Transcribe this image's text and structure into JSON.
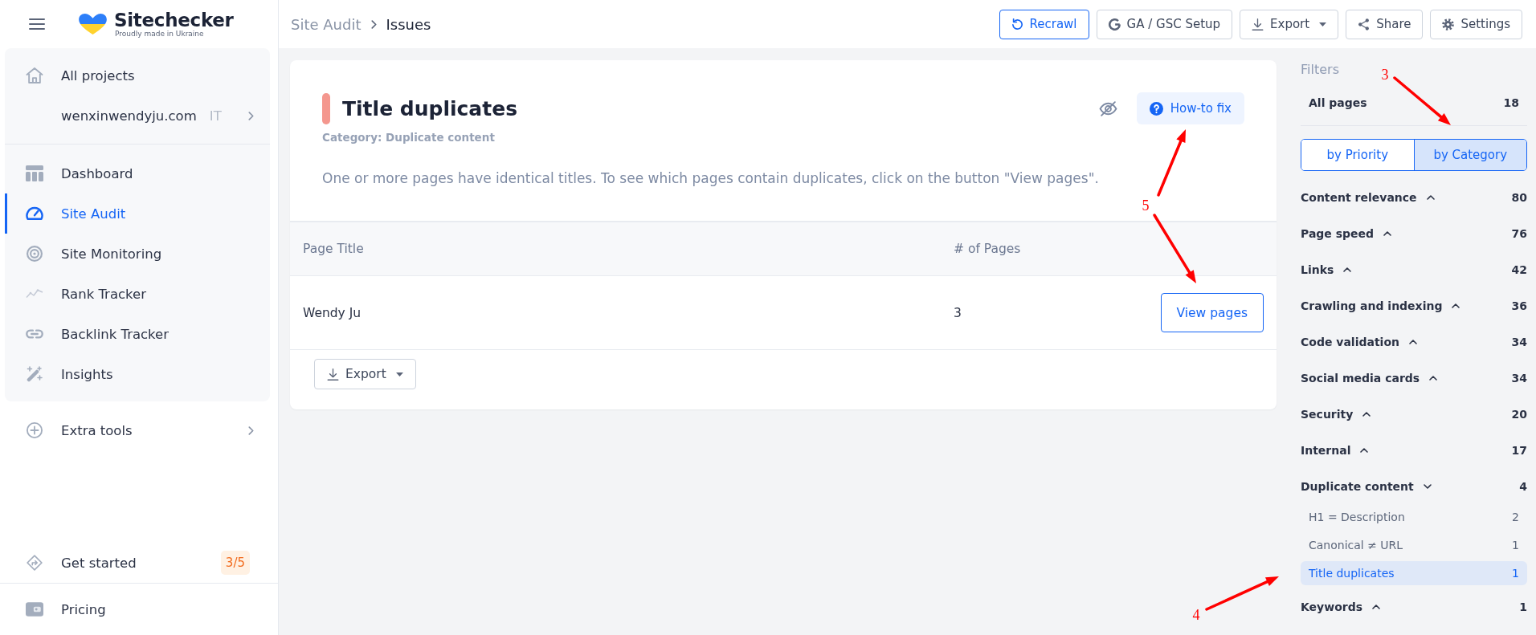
{
  "header": {
    "brand": {
      "name": "Sitechecker",
      "tagline": "Proudly made in Ukraine"
    },
    "breadcrumb": [
      "Site Audit",
      "Issues"
    ],
    "actions": [
      {
        "label": "Recrawl",
        "kind": "primary",
        "dropdown": false
      },
      {
        "label": "GA / GSC Setup",
        "kind": "default",
        "dropdown": false
      },
      {
        "label": "Export",
        "kind": "default",
        "dropdown": true
      },
      {
        "label": "Share",
        "kind": "default",
        "dropdown": false
      },
      {
        "label": "Settings",
        "kind": "default",
        "dropdown": false
      }
    ]
  },
  "sidebar": {
    "all_projects": "All projects",
    "project": {
      "label": "wenxinwendyju.com",
      "tag": "IT"
    },
    "nav": [
      {
        "label": "Dashboard",
        "selected": false
      },
      {
        "label": "Site Audit",
        "selected": true
      },
      {
        "label": "Site Monitoring",
        "selected": false
      },
      {
        "label": "Rank Tracker",
        "selected": false
      },
      {
        "label": "Backlink Tracker",
        "selected": false
      },
      {
        "label": "Insights",
        "selected": false
      }
    ],
    "extra_tools": "Extra tools",
    "get_started": {
      "label": "Get started",
      "badge": "3/5"
    },
    "pricing": "Pricing"
  },
  "issue": {
    "title": "Title duplicates",
    "category": "Category: Duplicate content",
    "description": "One or more pages have identical titles. To see which pages contain duplicates, click on the button \"View pages\".",
    "help_button": "How-to fix",
    "table": {
      "columns": [
        "Page Title",
        "# of Pages"
      ],
      "rows": [
        {
          "title": "Wendy Ju",
          "pages": "3",
          "action": "View pages"
        }
      ]
    },
    "export": {
      "label": "Export",
      "dropdown": true
    }
  },
  "filters": {
    "title": "Filters",
    "all_pages": {
      "label": "All pages",
      "count": "18"
    },
    "modes": [
      {
        "label": "by Priority",
        "selected": false
      },
      {
        "label": "by Category",
        "selected": true
      }
    ],
    "categories": [
      {
        "label": "Content relevance",
        "count": "80",
        "expanded": false
      },
      {
        "label": "Page speed",
        "count": "76",
        "expanded": false
      },
      {
        "label": "Links",
        "count": "42",
        "expanded": false
      },
      {
        "label": "Crawling and indexing",
        "count": "36",
        "expanded": false
      },
      {
        "label": "Code validation",
        "count": "34",
        "expanded": false
      },
      {
        "label": "Social media cards",
        "count": "34",
        "expanded": false
      },
      {
        "label": "Security",
        "count": "20",
        "expanded": false
      },
      {
        "label": "Internal",
        "count": "17",
        "expanded": false
      },
      {
        "label": "Duplicate content",
        "count": "4",
        "expanded": true,
        "children": [
          {
            "label": "H1 = Description",
            "count": "2",
            "selected": false
          },
          {
            "label": "Canonical ≠ URL",
            "count": "1",
            "selected": false
          },
          {
            "label": "Title duplicates",
            "count": "1",
            "selected": true
          }
        ]
      },
      {
        "label": "Keywords",
        "count": "1",
        "expanded": false
      }
    ]
  },
  "annotations": [
    {
      "label": "3"
    },
    {
      "label": "5"
    },
    {
      "label": "4"
    }
  ]
}
